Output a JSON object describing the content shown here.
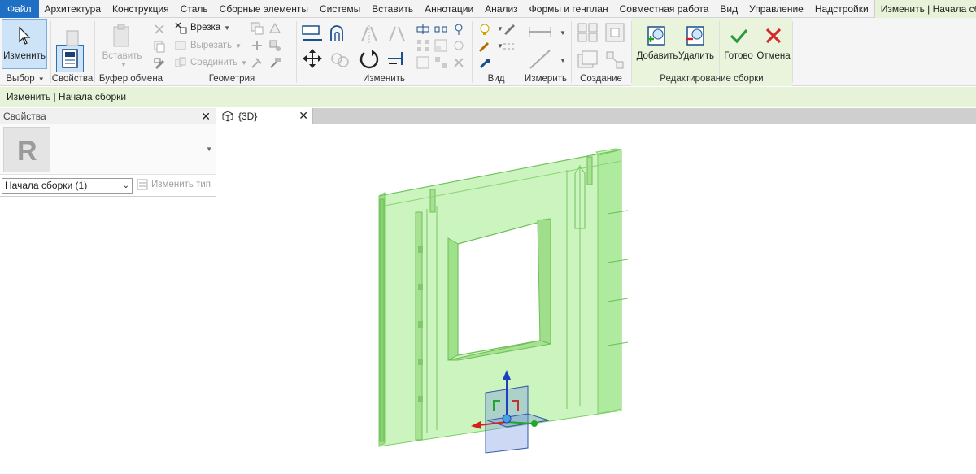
{
  "tabs": [
    "Файл",
    "Архитектура",
    "Конструкция",
    "Сталь",
    "Сборные элементы",
    "Системы",
    "Вставить",
    "Аннотации",
    "Анализ",
    "Формы и генплан",
    "Совместная работа",
    "Вид",
    "Управление",
    "Надстройки",
    "Изменить | Начала сборки"
  ],
  "ribbon": {
    "select": {
      "modify_label": "Изменить",
      "title": "Выбор"
    },
    "properties": {
      "label": "Свойства"
    },
    "clipboard": {
      "paste_label": "Вставить",
      "title": "Буфер обмена"
    },
    "geometry": {
      "cope": "Врезка",
      "cut": "Вырезать",
      "join": "Соединить",
      "title": "Геометрия"
    },
    "modify": {
      "title": "Изменить"
    },
    "view": {
      "title": "Вид"
    },
    "measure": {
      "title": "Измерить"
    },
    "create": {
      "title": "Создание"
    },
    "edit_assembly": {
      "add": "Добавить",
      "remove": "Удалить",
      "title": "Редактирование сборки"
    },
    "mode": {
      "finish": "Готово",
      "cancel": "Отмена"
    }
  },
  "options_bar": {
    "text": "Изменить | Начала сборки"
  },
  "properties": {
    "header": "Свойства",
    "filter_value": "Начала сборки (1)",
    "edit_type": "Изменить тип"
  },
  "view": {
    "tab_label": "{3D}"
  },
  "colors": {
    "file_tab": "#1f6fc5",
    "context_tab": "#e6f3d8",
    "model_fill": "#9ee58a",
    "model_edge": "#6fbf5a"
  }
}
